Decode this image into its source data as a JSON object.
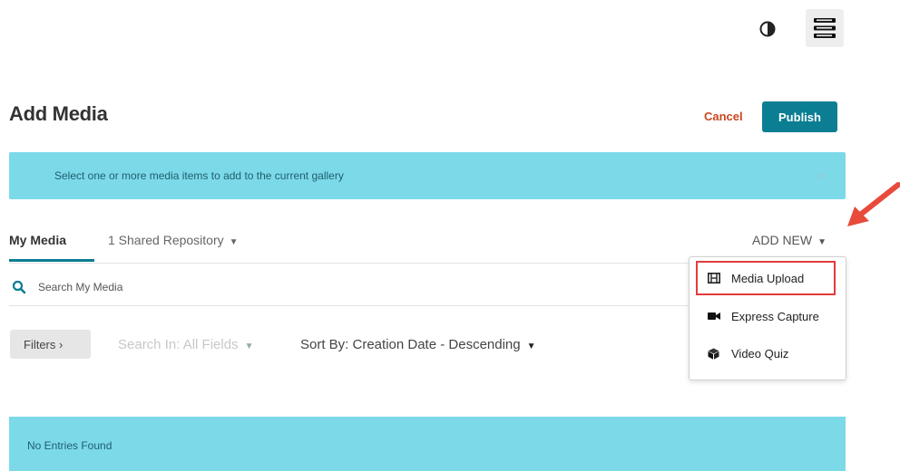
{
  "header": {
    "contrast_icon": "contrast-icon",
    "menu_icon": "hamburger-menu-icon"
  },
  "page": {
    "title": "Add Media",
    "cancel_label": "Cancel",
    "publish_label": "Publish"
  },
  "info_bar": {
    "message": "Select one or more media items to add to the current gallery",
    "close_label": "×"
  },
  "tabs": [
    {
      "label": "My Media",
      "active": true
    },
    {
      "label": "1 Shared Repository",
      "active": false,
      "chevron": "⌄"
    }
  ],
  "add_new": {
    "label": "ADD NEW",
    "chevron": "⌄",
    "items": [
      {
        "label": "Media Upload",
        "icon": "film-icon"
      },
      {
        "label": "Express Capture",
        "icon": "video-camera-icon"
      },
      {
        "label": "Video Quiz",
        "icon": "cube-icon"
      }
    ]
  },
  "search": {
    "placeholder": "Search My Media",
    "icon": "search-icon"
  },
  "filters": {
    "filters_label": "Filters ›",
    "search_in": "Search In: All Fields",
    "sort_by": "Sort By: Creation Date - Descending"
  },
  "results": {
    "empty_message": "No Entries Found"
  },
  "colors": {
    "accent": "#0b7e93",
    "info_bg": "#7cd9e8",
    "cancel": "#c9481f",
    "highlight": "#e33b3b"
  }
}
